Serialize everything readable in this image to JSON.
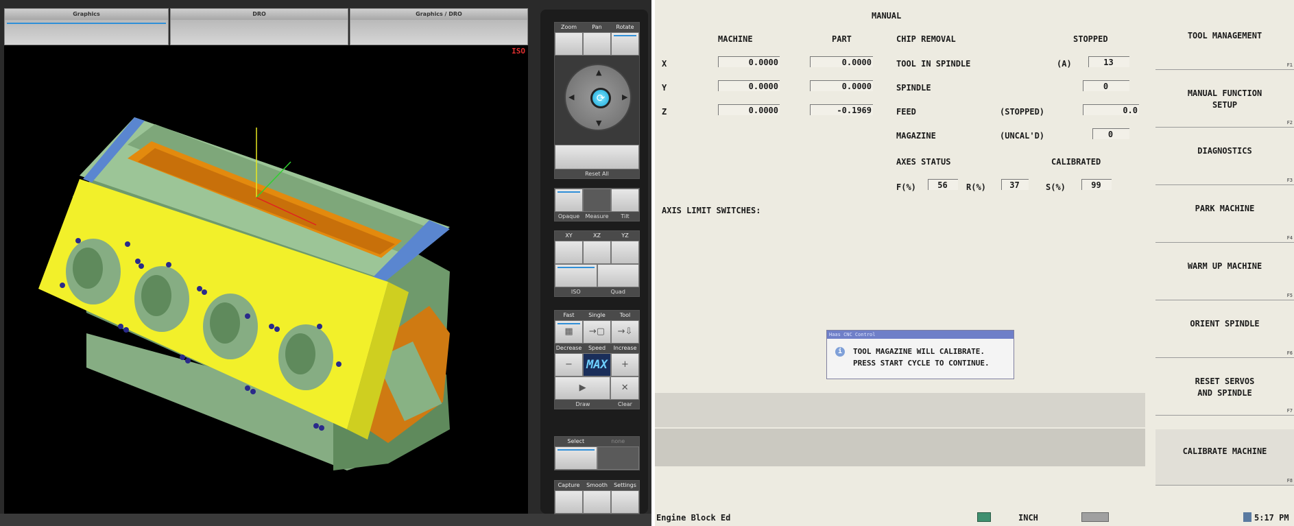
{
  "left_app": {
    "tabs": [
      "Graphics",
      "DRO",
      "Graphics / DRO"
    ],
    "view_label": "ISO",
    "view_controls": {
      "header": [
        "Zoom",
        "Pan",
        "Rotate"
      ],
      "reset_label": "Reset All"
    },
    "display_group": {
      "labels": [
        "Opaque",
        "Measure",
        "Tilt"
      ]
    },
    "planes_group": {
      "header": [
        "XY",
        "XZ",
        "YZ"
      ],
      "labels": [
        "ISO",
        "Quad"
      ]
    },
    "sim_group": {
      "header": [
        "Fast",
        "Single",
        "Tool"
      ],
      "speed_header": [
        "Decrease",
        "Speed",
        "Increase"
      ],
      "speed_value": "MAX",
      "footer": [
        "Draw",
        "Clear"
      ]
    },
    "select_group": {
      "header": [
        "Select",
        "none"
      ]
    },
    "bottom_group": {
      "header": [
        "Capture",
        "Smooth",
        "Settings"
      ]
    }
  },
  "haas": {
    "mode_title": "MANUAL",
    "col_machine": "MACHINE",
    "col_part": "PART",
    "axes": [
      {
        "name": "X",
        "machine": "0.0000",
        "part": "0.0000"
      },
      {
        "name": "Y",
        "machine": "0.0000",
        "part": "0.0000"
      },
      {
        "name": "Z",
        "machine": "0.0000",
        "part": "-0.1969"
      }
    ],
    "chip_removal": "CHIP REMOVAL",
    "stopped": "STOPPED",
    "tool_in_spindle": "TOOL IN SPINDLE",
    "tool_slot": "(A)",
    "tool_value": "13",
    "spindle": "SPINDLE",
    "spindle_value": "0",
    "feed": "FEED",
    "feed_state": "(STOPPED)",
    "feed_value": "0.0",
    "magazine": "MAGAZINE",
    "magazine_state": "(UNCAL'D)",
    "magazine_value": "0",
    "axes_status": "AXES STATUS",
    "calibrated": "CALIBRATED",
    "overrides": [
      {
        "label": "F(%)",
        "value": "56"
      },
      {
        "label": "R(%)",
        "value": "37"
      },
      {
        "label": "S(%)",
        "value": "99"
      }
    ],
    "axis_limit": "AXIS LIMIT SWITCHES:",
    "menu": [
      {
        "label": "TOOL MANAGEMENT",
        "key": "F1"
      },
      {
        "label": "MANUAL FUNCTION SETUP",
        "key": "F2"
      },
      {
        "label": "DIAGNOSTICS",
        "key": "F3"
      },
      {
        "label": "PARK MACHINE",
        "key": "F4"
      },
      {
        "label": "WARM UP MACHINE",
        "key": "F5"
      },
      {
        "label": "ORIENT SPINDLE",
        "key": "F6"
      },
      {
        "label": "RESET SERVOS AND SPINDLE",
        "key": "F7"
      },
      {
        "label": "CALIBRATE MACHINE",
        "key": "F8"
      }
    ],
    "dialog": {
      "title": "Haas CNC Control",
      "line1": "TOOL MAGAZINE WILL CALIBRATE.",
      "line2": "PRESS START CYCLE TO CONTINUE."
    },
    "status": {
      "file": "Engine Block Ed",
      "units": "INCH",
      "time": "5:17 PM"
    }
  },
  "colors": {
    "engine_green": "#8db58a",
    "engine_yellow": "#f2f02a",
    "engine_orange": "#e38a0e",
    "accent_blue": "#2f8fd8"
  }
}
